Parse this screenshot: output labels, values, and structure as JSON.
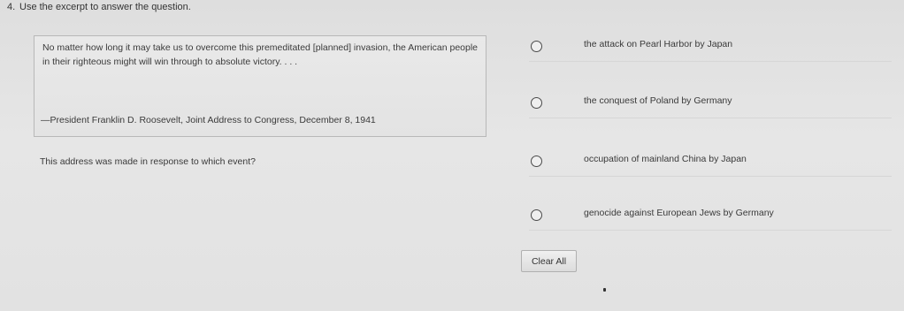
{
  "question": {
    "number": "4.",
    "prompt": "Use the excerpt to answer the question.",
    "excerpt": "No matter how long it may take us to overcome this premeditated [planned] invasion, the American people in their righteous might will win through to absolute victory. . . .",
    "attribution": "—President Franklin D. Roosevelt, Joint Address to Congress, December 8, 1941",
    "text": "This address was made in response to which event?"
  },
  "options": [
    {
      "label": "the attack on Pearl Harbor by Japan",
      "selected": false
    },
    {
      "label": "the conquest of Poland by Germany",
      "selected": false
    },
    {
      "label": "occupation of mainland China by Japan",
      "selected": false
    },
    {
      "label": "genocide against European Jews by Germany",
      "selected": false
    }
  ],
  "controls": {
    "clear_all_label": "Clear All"
  }
}
